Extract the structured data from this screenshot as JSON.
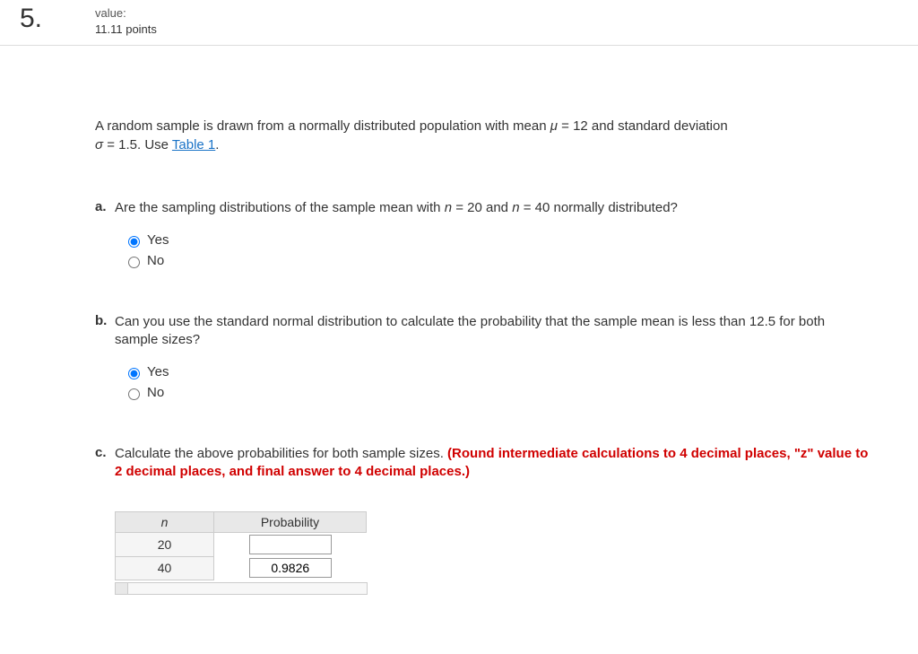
{
  "header": {
    "number": "5.",
    "value_label": "value:",
    "points": "11.11 points"
  },
  "intro": {
    "text_before_mu": "A random sample is drawn from a normally distributed population with mean ",
    "mu": "μ",
    "eq_mu": " = 12 and standard deviation ",
    "sigma": "σ",
    "eq_sigma": " = 1.5. Use ",
    "table_link": "Table 1",
    "period": "."
  },
  "parts": {
    "a": {
      "label": "a.",
      "q_before": "Are the sampling distributions of the sample mean with ",
      "n1": "n",
      "n1_after": " = 20 and ",
      "n2": "n",
      "n2_after": " = 40 normally distributed?",
      "options": {
        "yes": "Yes",
        "no": "No"
      },
      "selected": "yes"
    },
    "b": {
      "label": "b.",
      "q": "Can you use the standard normal distribution to calculate the probability that the sample mean is less than 12.5 for both sample sizes?",
      "options": {
        "yes": "Yes",
        "no": "No"
      },
      "selected": "yes"
    },
    "c": {
      "label": "c.",
      "q": "Calculate the above probabilities for both sample sizes. ",
      "hint": "(Round intermediate calculations to 4 decimal places, \"z\" value to 2 decimal places, and final answer to 4 decimal places.)",
      "table": {
        "head_n": "n",
        "head_p": "Probability",
        "rows": [
          {
            "n": "20",
            "prob": ""
          },
          {
            "n": "40",
            "prob": "0.9826"
          }
        ]
      }
    }
  }
}
